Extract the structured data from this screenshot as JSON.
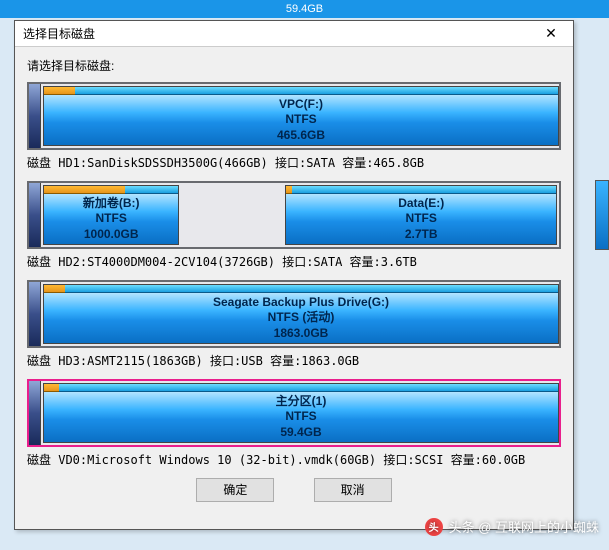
{
  "banner": "59.4GB",
  "dialog": {
    "title": "选择目标磁盘",
    "instruction": "请选择目标磁盘:",
    "ok": "确定",
    "cancel": "取消"
  },
  "disks": [
    {
      "caption": "磁盘 HD1:SanDiskSDSSDH3500G(466GB) 接口:SATA 容量:465.8GB",
      "selected": false,
      "partitions": [
        {
          "label": "VPC(F:)",
          "fs": "NTFS",
          "size": "465.6GB",
          "widthPct": 100,
          "usedPct": 6
        }
      ]
    },
    {
      "caption": "磁盘 HD2:ST4000DM004-2CV104(3726GB) 接口:SATA 容量:3.6TB",
      "selected": false,
      "partitions": [
        {
          "label": "新加卷(B:)",
          "fs": "NTFS",
          "size": "1000.0GB",
          "widthPct": 27,
          "usedPct": 60
        },
        {
          "label": "Data(E:)",
          "fs": "NTFS",
          "size": "2.7TB",
          "widthPct": 73,
          "usedPct": 2,
          "offsetPct": 20
        }
      ]
    },
    {
      "caption": "磁盘 HD3:ASMT2115(1863GB) 接口:USB 容量:1863.0GB",
      "selected": false,
      "partitions": [
        {
          "label": "Seagate Backup Plus Drive(G:)",
          "fs": "NTFS (活动)",
          "size": "1863.0GB",
          "widthPct": 100,
          "usedPct": 4
        }
      ]
    },
    {
      "caption": "磁盘 VD0:Microsoft Windows 10 (32-bit).vmdk(60GB) 接口:SCSI 容量:60.0GB",
      "selected": true,
      "partitions": [
        {
          "label": "主分区(1)",
          "fs": "NTFS",
          "size": "59.4GB",
          "widthPct": 100,
          "usedPct": 3
        }
      ]
    }
  ],
  "watermark": "头条 @ 互联网上的小蜘蛛"
}
